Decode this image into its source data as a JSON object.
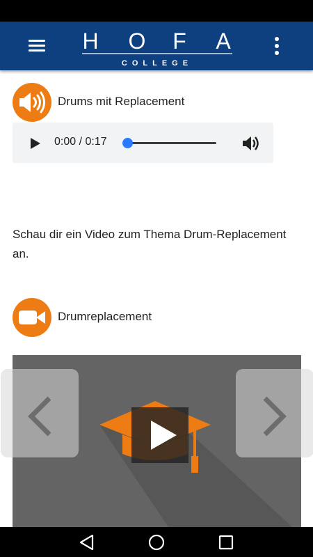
{
  "app": {
    "logo_letters": [
      "H",
      "O",
      "F",
      "A"
    ],
    "logo_subtitle": "COLLEGE",
    "brand_color": "#0e3f7f",
    "accent_color": "#ec7c13"
  },
  "header": {
    "menu_icon": "hamburger-menu-icon",
    "more_icon": "more-vertical-icon"
  },
  "audio_section": {
    "icon": "speaker-icon",
    "title": "Drums mit Replacement",
    "player": {
      "current_time": "0:00",
      "duration": "0:17",
      "time_display": "0:00 / 0:17",
      "progress": 0.0,
      "play_icon": "play-icon",
      "volume_icon": "volume-icon"
    }
  },
  "description": "Schau dir ein Video zum Thema Drum-Replacement an.",
  "video_section": {
    "icon": "video-camera-icon",
    "title": "Drumreplacement",
    "thumbnail_icon": "graduation-cap-icon",
    "play_icon": "play-icon"
  },
  "pager": {
    "prev_icon": "chevron-left-icon",
    "next_icon": "chevron-right-icon"
  },
  "system_nav": {
    "back_icon": "back-triangle-icon",
    "home_icon": "home-circle-icon",
    "recents_icon": "recents-square-icon"
  }
}
